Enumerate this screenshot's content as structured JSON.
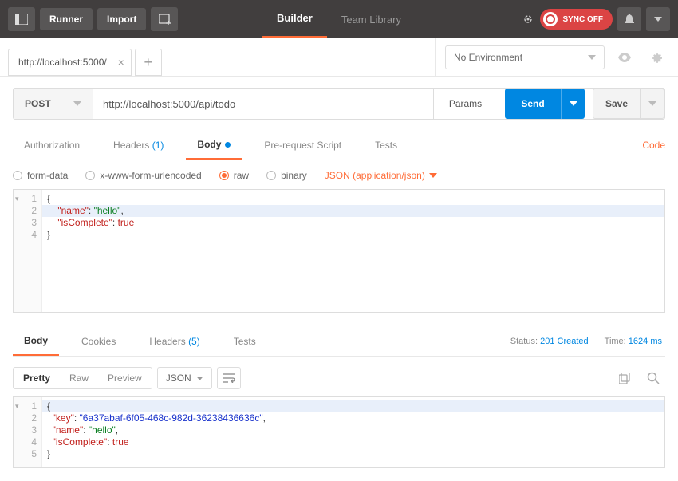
{
  "topbar": {
    "runner": "Runner",
    "import": "Import",
    "nav_builder": "Builder",
    "nav_team": "Team Library",
    "sync": "SYNC OFF"
  },
  "env": {
    "selected": "No Environment"
  },
  "tabs": {
    "t0": "http://localhost:5000/"
  },
  "request": {
    "method": "POST",
    "url": "http://localhost:5000/api/todo",
    "params": "Params",
    "send": "Send",
    "save": "Save"
  },
  "reqTabs": {
    "auth": "Authorization",
    "headers": "Headers",
    "headers_count": "(1)",
    "body": "Body",
    "pre": "Pre-request Script",
    "tests": "Tests",
    "code": "Code"
  },
  "bodyOpts": {
    "form": "form-data",
    "xwww": "x-www-form-urlencoded",
    "raw": "raw",
    "binary": "binary",
    "json": "JSON (application/json)"
  },
  "reqBody": {
    "l1": "{",
    "l2_k": "\"name\"",
    "l2_v": "\"hello\"",
    "l3_k": "\"isComplete\"",
    "l3_v": "true",
    "l4": "}"
  },
  "respTabs": {
    "body": "Body",
    "cookies": "Cookies",
    "headers": "Headers",
    "headers_count": "(5)",
    "tests": "Tests"
  },
  "status": {
    "status_lbl": "Status:",
    "status_val": "201 Created",
    "time_lbl": "Time:",
    "time_val": "1624 ms"
  },
  "respTools": {
    "pretty": "Pretty",
    "raw": "Raw",
    "preview": "Preview",
    "json": "JSON"
  },
  "respBody": {
    "l1": "{",
    "l2_k": "\"key\"",
    "l2_v": "\"6a37abaf-6f05-468c-982d-36238436636c\"",
    "l3_k": "\"name\"",
    "l3_v": "\"hello\"",
    "l4_k": "\"isComplete\"",
    "l4_v": "true",
    "l5": "}"
  }
}
